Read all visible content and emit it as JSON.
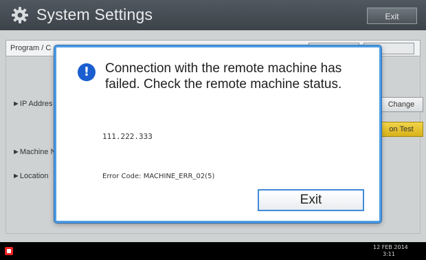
{
  "titlebar": {
    "title": "System Settings",
    "icon": "gear-icon",
    "exit_label": "Exit"
  },
  "breadcrumb": {
    "text": "Program / C"
  },
  "background": {
    "items": [
      "►IP Addres",
      "►Machine N",
      "►Location"
    ],
    "change_label": "Change",
    "test_label": "on Test"
  },
  "dialog": {
    "message": "Connection with the remote machine has failed. Check the remote machine status.",
    "address": "111.222.333",
    "error_code": "Error Code: MACHINE_ERR_02(5)",
    "exit_label": "Exit",
    "icon": "alert-icon"
  },
  "statusbar": {
    "date": "12 FEB  2014",
    "time": "3:11"
  },
  "colors": {
    "titlebar": "#444b51",
    "dialog_border": "#4c9be3",
    "alert_icon": "#1a5ecf",
    "test_button": "#e6c433"
  }
}
